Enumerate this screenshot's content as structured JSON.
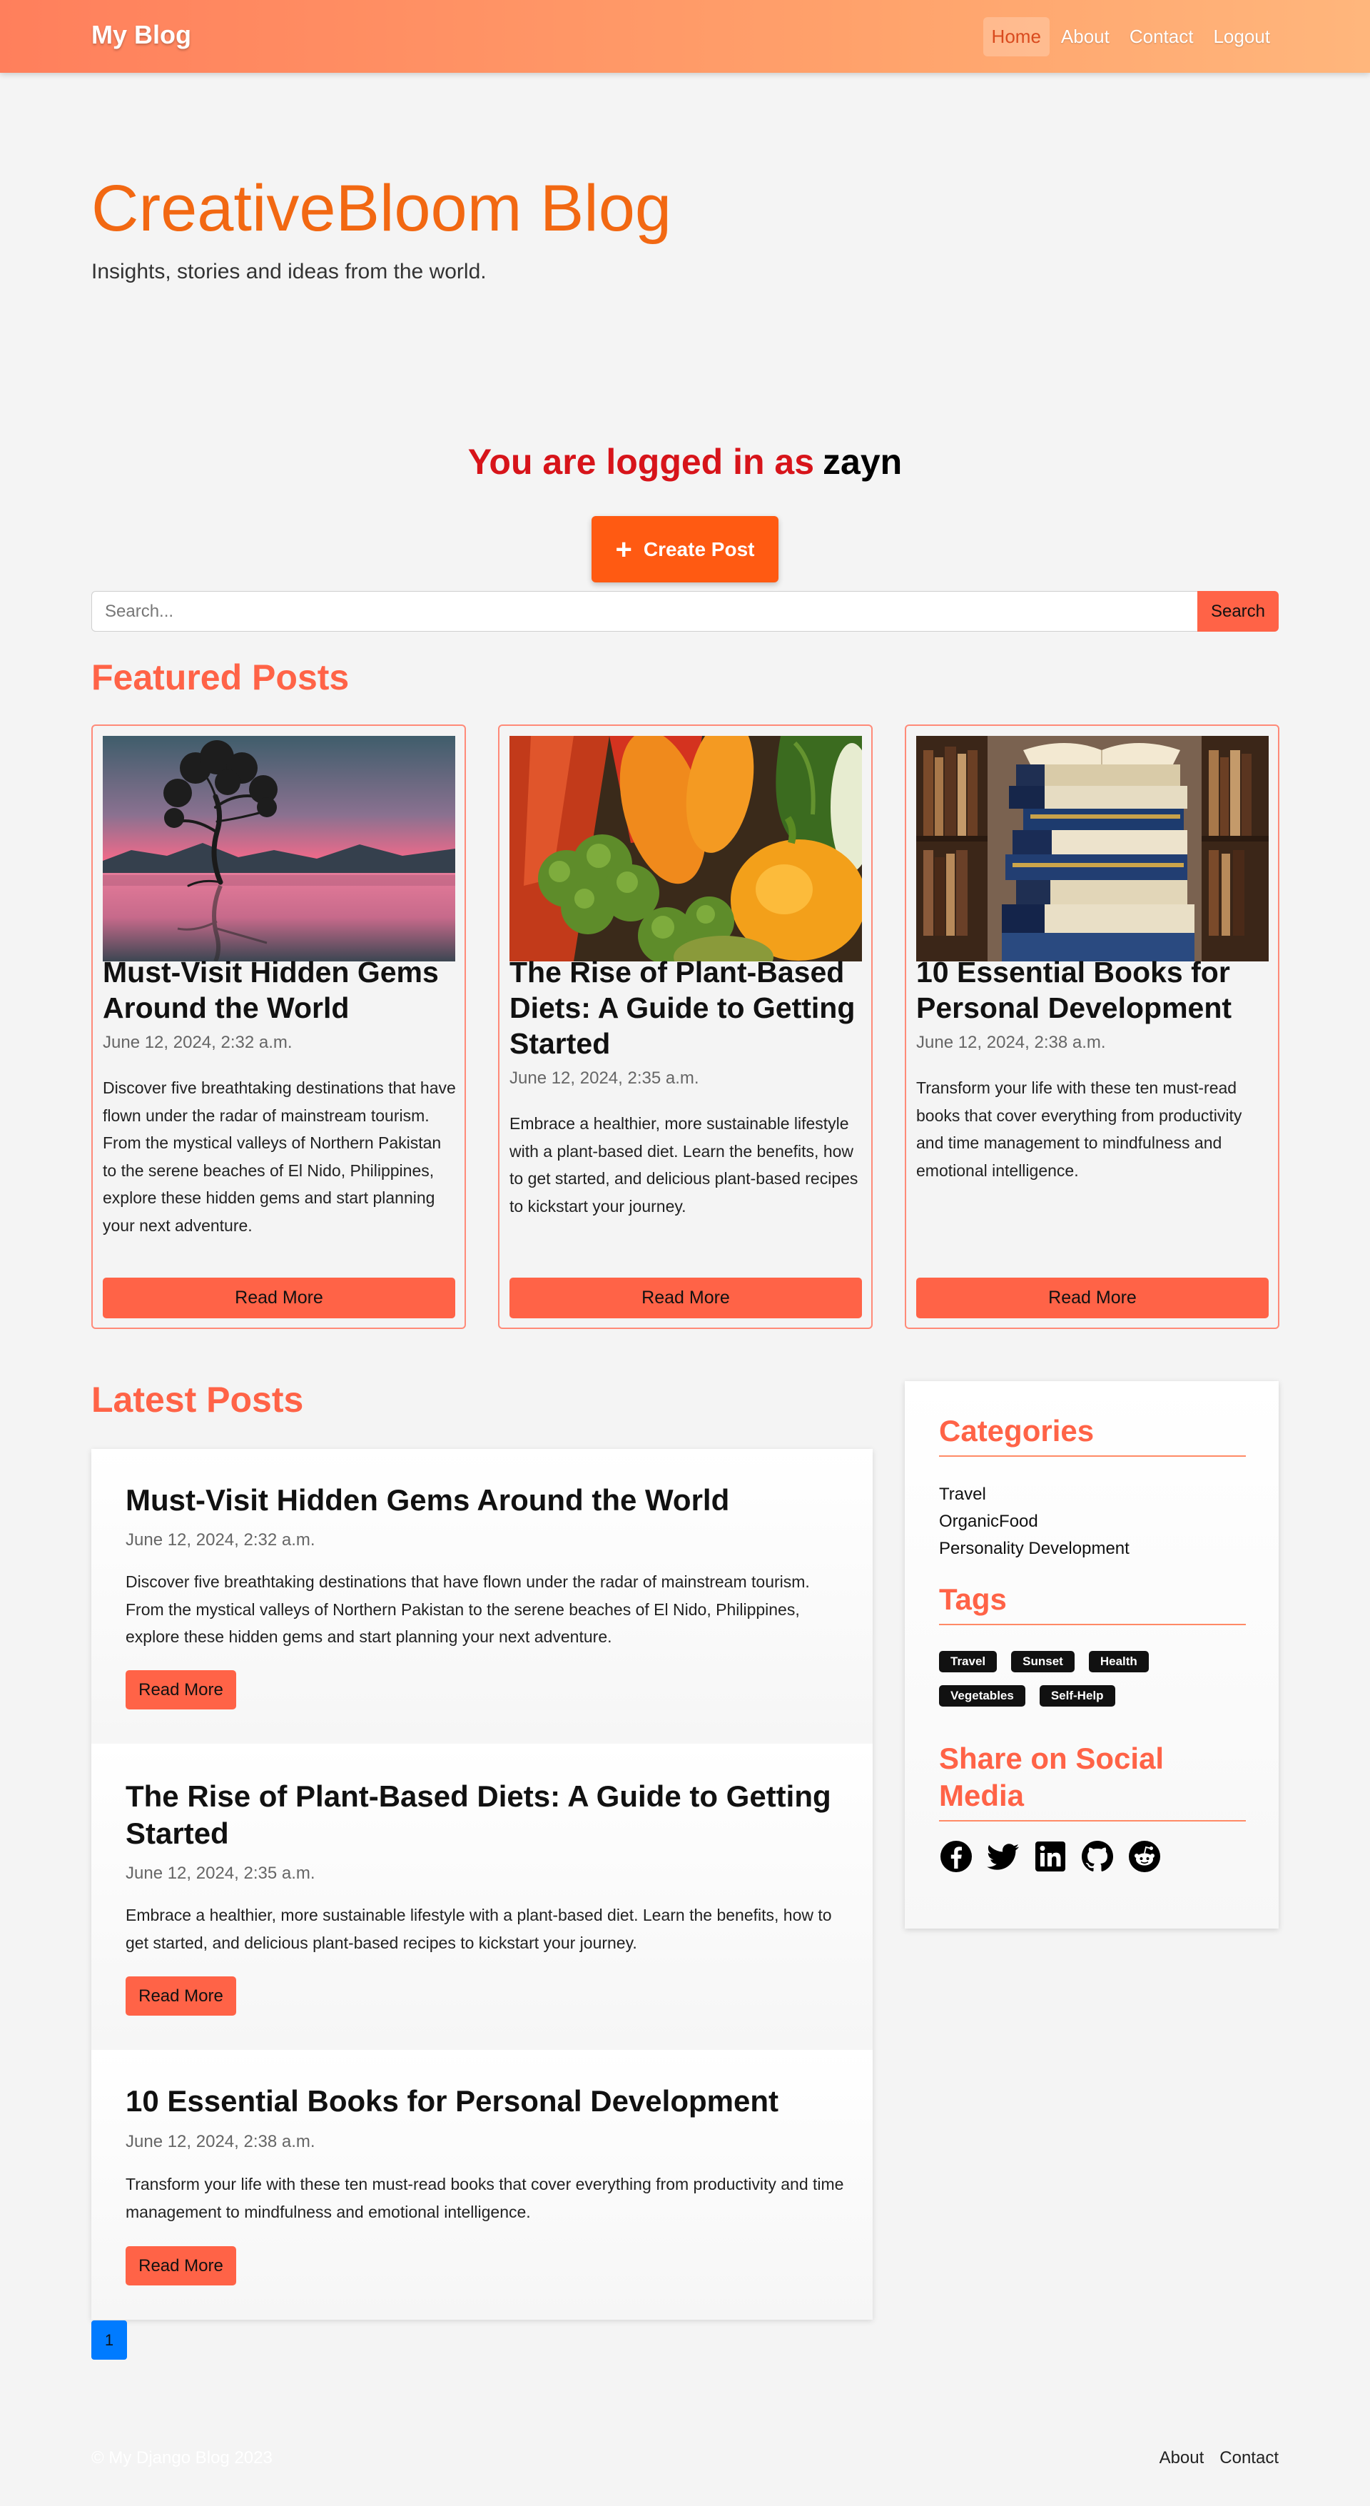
{
  "nav": {
    "brand": "My Blog",
    "links": [
      "Home",
      "About",
      "Contact",
      "Logout"
    ],
    "active": "Home"
  },
  "hero": {
    "title": "CreativeBloom Blog",
    "subtitle": "Insights, stories and ideas from the world."
  },
  "user": {
    "label": "You are logged in as",
    "username": "zayn"
  },
  "create_post": {
    "icon": "plus-icon",
    "label": "Create Post"
  },
  "search": {
    "placeholder": "Search...",
    "value": "",
    "button": "Search"
  },
  "featured": {
    "heading": "Featured Posts",
    "posts": [
      {
        "title": "Must-Visit Hidden Gems Around the World",
        "date": "June 12, 2024, 2:32 a.m.",
        "excerpt": "Discover five breathtaking destinations that have flown under the radar of mainstream tourism. From the mystical valleys of Northern Pakistan to the serene beaches of El Nido, Philippines, explore these hidden gems and start planning your next adventure.",
        "button": "Read More",
        "image": "lone-tree-lake-sunset"
      },
      {
        "title": "The Rise of Plant-Based Diets: A Guide to Getting Started",
        "date": "June 12, 2024, 2:35 a.m.",
        "excerpt": "Embrace a healthier, more sustainable lifestyle with a plant-based diet. Learn the benefits, how to get started, and delicious plant-based recipes to kickstart your journey.",
        "button": "Read More",
        "image": "vegetables"
      },
      {
        "title": "10 Essential Books for Personal Development",
        "date": "June 12, 2024, 2:38 a.m.",
        "excerpt": "Transform your life with these ten must-read books that cover everything from productivity and time management to mindfulness and emotional intelligence.",
        "button": "Read More",
        "image": "book-stack"
      }
    ]
  },
  "latest": {
    "heading": "Latest Posts",
    "posts": [
      {
        "title": "Must-Visit Hidden Gems Around the World",
        "date": "June 12, 2024, 2:32 a.m.",
        "excerpt": "Discover five breathtaking destinations that have flown under the radar of mainstream tourism. From the mystical valleys of Northern Pakistan to the serene beaches of El Nido, Philippines, explore these hidden gems and start planning your next adventure.",
        "button": "Read More"
      },
      {
        "title": "The Rise of Plant-Based Diets: A Guide to Getting Started",
        "date": "June 12, 2024, 2:35 a.m.",
        "excerpt": "Embrace a healthier, more sustainable lifestyle with a plant-based diet. Learn the benefits, how to get started, and delicious plant-based recipes to kickstart your journey.",
        "button": "Read More"
      },
      {
        "title": "10 Essential Books for Personal Development",
        "date": "June 12, 2024, 2:38 a.m.",
        "excerpt": "Transform your life with these ten must-read books that cover everything from productivity and time management to mindfulness and emotional intelligence.",
        "button": "Read More"
      }
    ]
  },
  "pagination": {
    "current": "1"
  },
  "sidebar": {
    "categories_heading": "Categories",
    "categories": [
      "Travel",
      "OrganicFood",
      "Personality Development"
    ],
    "tags_heading": "Tags",
    "tags": [
      "Travel",
      "Sunset",
      "Health",
      "Vegetables",
      "Self-Help"
    ],
    "social_heading": "Share on Social Media",
    "socials": [
      "facebook-icon",
      "twitter-icon",
      "linkedin-icon",
      "github-icon",
      "reddit-icon"
    ]
  },
  "footer": {
    "copyright": "© My Django Blog 2023",
    "links": [
      "About",
      "Contact"
    ]
  },
  "colors": {
    "accent": "#ff6347",
    "hero_title": "#f26812",
    "create_button": "#ff5a12",
    "login_label": "#d7141a",
    "page_button": "#007bff"
  }
}
